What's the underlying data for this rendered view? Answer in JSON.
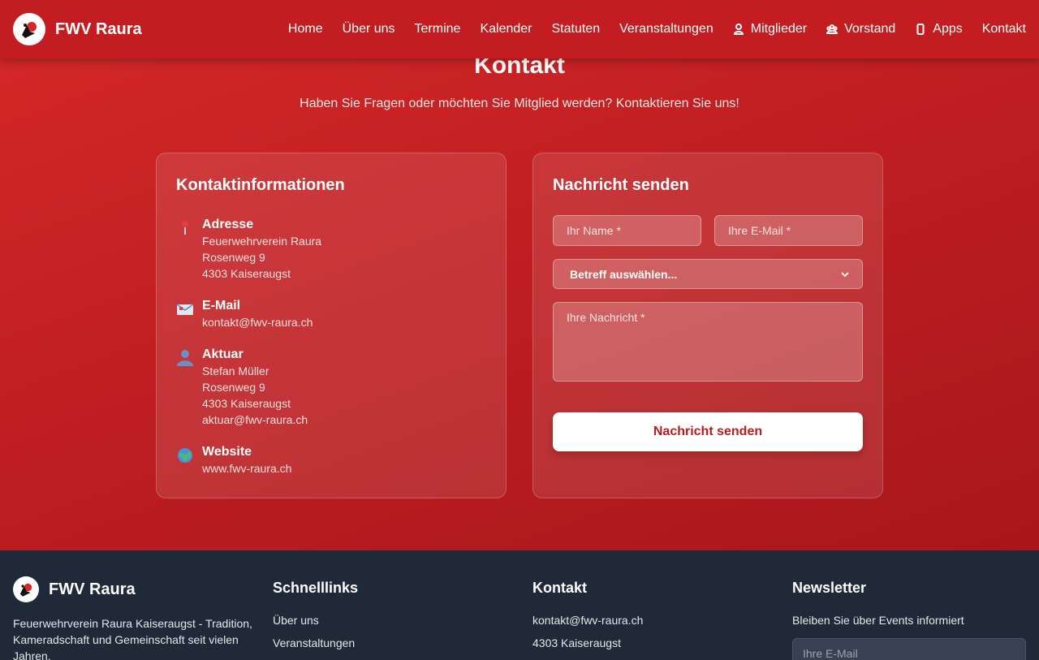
{
  "header": {
    "brand": "FWV Raura",
    "nav": [
      {
        "label": "Home",
        "icon": ""
      },
      {
        "label": "Über uns",
        "icon": ""
      },
      {
        "label": "Termine",
        "icon": ""
      },
      {
        "label": "Kalender",
        "icon": ""
      },
      {
        "label": "Statuten",
        "icon": ""
      },
      {
        "label": "Veranstaltungen",
        "icon": ""
      },
      {
        "label": "Mitglieder",
        "icon": "user-icon"
      },
      {
        "label": "Vorstand",
        "icon": "group-icon"
      },
      {
        "label": "Apps",
        "icon": "phone-icon"
      },
      {
        "label": "Kontakt",
        "icon": ""
      }
    ]
  },
  "main": {
    "title": "Kontakt",
    "subtitle": "Haben Sie Fragen oder möchten Sie Mitglied werden? Kontaktieren Sie uns!",
    "info": {
      "title": "Kontaktinformationen",
      "address": {
        "label": "Adresse",
        "lines": [
          "Feuerwehrverein Raura",
          "Rosenweg 9",
          "4303 Kaiseraugst"
        ]
      },
      "email": {
        "label": "E-Mail",
        "value": "kontakt@fwv-raura.ch"
      },
      "aktuar": {
        "label": "Aktuar",
        "lines": [
          "Stefan Müller",
          "Rosenweg 9",
          "4303 Kaiseraugst",
          "aktuar@fwv-raura.ch"
        ]
      },
      "website": {
        "label": "Website",
        "value": "www.fwv-raura.ch"
      }
    },
    "form": {
      "title": "Nachricht senden",
      "name_placeholder": "Ihr Name *",
      "email_placeholder": "Ihre E-Mail *",
      "subject_selected": "Betreff auswählen...",
      "message_placeholder": "Ihre Nachricht *",
      "submit_label": "Nachricht senden"
    }
  },
  "footer": {
    "brand": "FWV Raura",
    "description": "Feuerwehrverein Raura Kaiseraugst - Tradition, Kameradschaft und Gemeinschaft seit vielen Jahren.",
    "links_heading": "Schnelllinks",
    "links": [
      "Über uns",
      "Veranstaltungen"
    ],
    "contact_heading": "Kontakt",
    "contact": [
      "kontakt@fwv-raura.ch",
      "4303 Kaiseraugst"
    ],
    "newsletter_heading": "Newsletter",
    "newsletter_text": "Bleiben Sie über Events informiert",
    "newsletter_placeholder": "Ihre E-Mail"
  },
  "colors": {
    "primary": "#c41d21",
    "footer": "#1f2937",
    "accent_text": "#b91c1c"
  }
}
